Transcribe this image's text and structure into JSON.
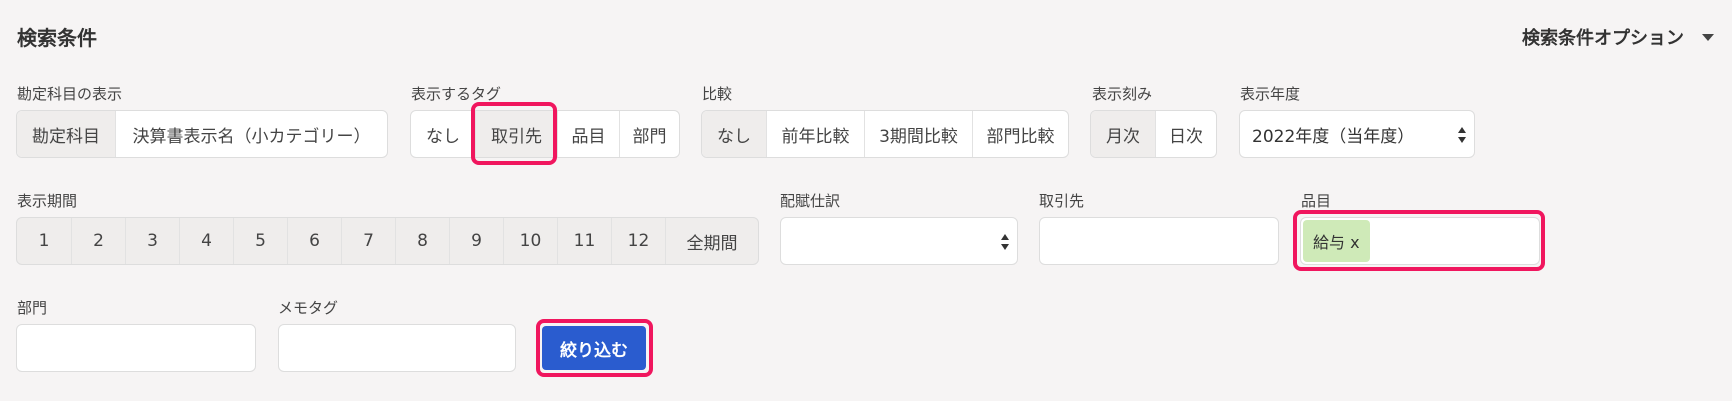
{
  "header": {
    "title": "検索条件",
    "options_label": "検索条件オプション"
  },
  "account_display": {
    "label": "勘定科目の表示",
    "options": [
      "勘定科目",
      "決算書表示名（小カテゴリー）"
    ],
    "active": 0
  },
  "display_tag": {
    "label": "表示するタグ",
    "options": [
      "なし",
      "取引先",
      "品目",
      "部門"
    ],
    "active": 1
  },
  "comparison": {
    "label": "比較",
    "options": [
      "なし",
      "前年比較",
      "3期間比較",
      "部門比較"
    ],
    "active": 0
  },
  "granularity": {
    "label": "表示刻み",
    "options": [
      "月次",
      "日次"
    ],
    "active": 0
  },
  "fiscal_year": {
    "label": "表示年度",
    "value": "2022年度（当年度）"
  },
  "period": {
    "label": "表示期間",
    "options": [
      "1",
      "2",
      "3",
      "4",
      "5",
      "6",
      "7",
      "8",
      "9",
      "10",
      "11",
      "12",
      "全期間"
    ]
  },
  "allocation": {
    "label": "配賦仕訳",
    "value": ""
  },
  "partner": {
    "label": "取引先",
    "value": ""
  },
  "item": {
    "label": "品目",
    "tags": [
      "給与 x"
    ]
  },
  "department": {
    "label": "部門",
    "value": ""
  },
  "memo_tag": {
    "label": "メモタグ",
    "value": ""
  },
  "filter_button": {
    "label": "絞り込む"
  },
  "colors": {
    "highlight": "#f0165e",
    "primary": "#2a5ccf",
    "tag_bg": "#cfeab8",
    "active_seg": "#efedec"
  }
}
